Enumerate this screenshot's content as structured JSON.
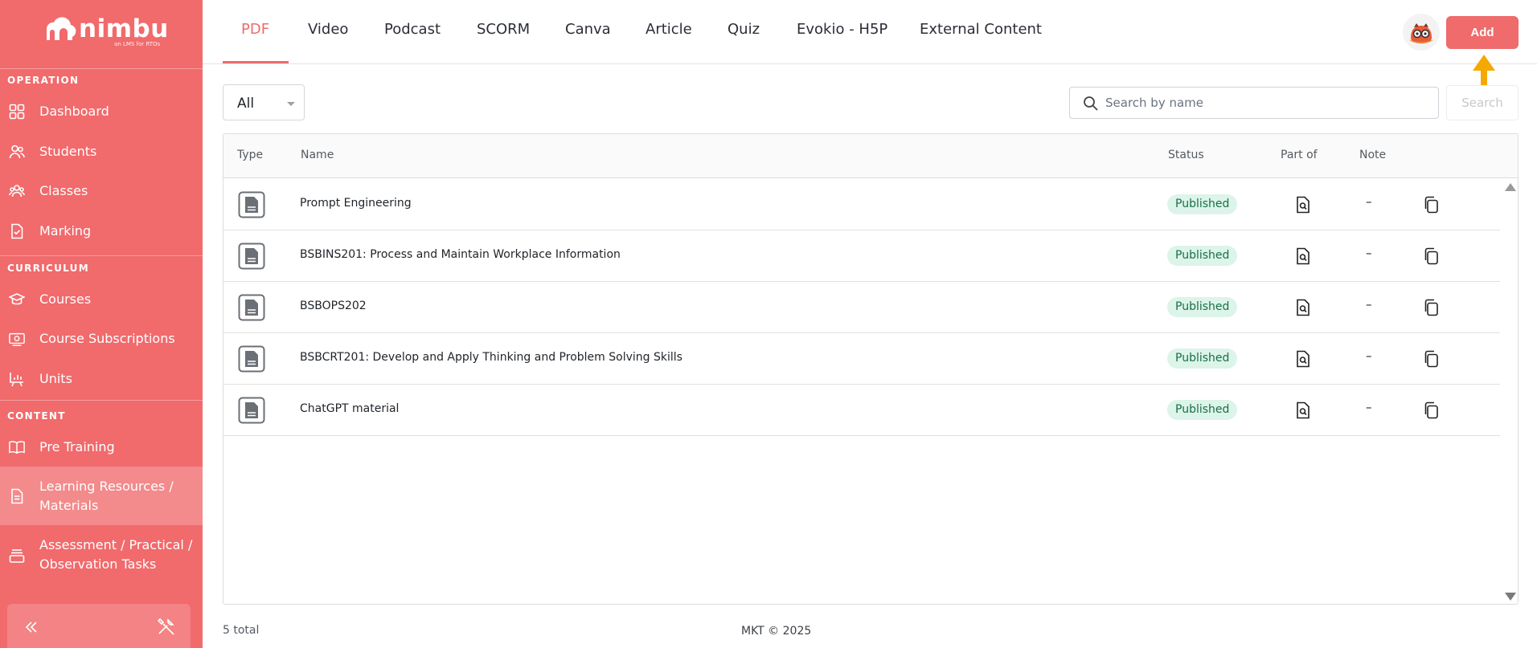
{
  "brand": {
    "name": "nimbu",
    "tagline": "an LMS for RTOs"
  },
  "sidebar": {
    "sections": [
      {
        "label": "OPERATION",
        "items": [
          {
            "label": "Dashboard",
            "icon": "grid-icon"
          },
          {
            "label": "Students",
            "icon": "users-icon"
          },
          {
            "label": "Classes",
            "icon": "group-icon"
          },
          {
            "label": "Marking",
            "icon": "check-doc-icon"
          }
        ]
      },
      {
        "label": "CURRICULUM",
        "items": [
          {
            "label": "Courses",
            "icon": "graduation-cap-icon"
          },
          {
            "label": "Course Subscriptions",
            "icon": "subscription-icon"
          },
          {
            "label": "Units",
            "icon": "chart-board-icon"
          }
        ]
      },
      {
        "label": "CONTENT",
        "items": [
          {
            "label": "Pre Training",
            "icon": "book-icon"
          },
          {
            "label": "Learning Resources / Materials",
            "label_line1": "Learning Resources /",
            "label_line2": "Materials",
            "icon": "document-icon",
            "active": true
          },
          {
            "label": "Assessment / Practical / Observation Tasks",
            "label_line1": "Assessment / Practical /",
            "label_line2": "Observation Tasks",
            "icon": "tray-icon"
          }
        ]
      }
    ]
  },
  "tabs": [
    "PDF",
    "Video",
    "Podcast",
    "SCORM",
    "Canva",
    "Article",
    "Quiz",
    "Evokio - H5P",
    "External Content"
  ],
  "active_tab": "PDF",
  "header": {
    "add_label": "Add"
  },
  "filter": {
    "selected": "All"
  },
  "search": {
    "placeholder": "Search by name",
    "value": "",
    "button_label": "Search"
  },
  "table": {
    "columns": [
      "Type",
      "Name",
      "Status",
      "Part of",
      "Note"
    ],
    "rows": [
      {
        "name": "Prompt Engineering",
        "status": "Published",
        "note": "–"
      },
      {
        "name": "BSBINS201: Process and Maintain Workplace Information",
        "status": "Published",
        "note": "–"
      },
      {
        "name": "BSBOPS202",
        "status": "Published",
        "note": "–"
      },
      {
        "name": "BSBCRT201: Develop and Apply Thinking and Problem Solving Skills",
        "status": "Published",
        "note": "–"
      },
      {
        "name": "ChatGPT material",
        "status": "Published",
        "note": "–"
      }
    ]
  },
  "total_label": "5 total",
  "footer": "MKT © 2025",
  "colors": {
    "brand": "#f16a6c",
    "accent": "#ef6b6c",
    "status_bg": "#dcf4ea",
    "status_text": "#1a6f47",
    "annotation_arrow": "#f5a800"
  }
}
